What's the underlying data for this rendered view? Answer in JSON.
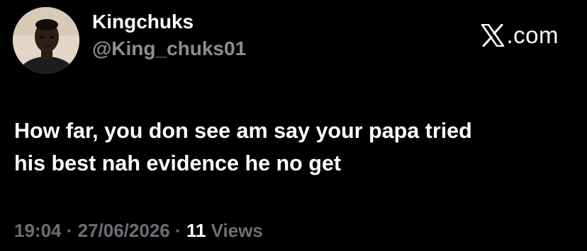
{
  "user": {
    "display_name": "Kingchuks",
    "handle": "@King_chuks01",
    "avatar": "profile-photo"
  },
  "brand": {
    "icon": "x-logo-icon",
    "label": ".com"
  },
  "tweet": {
    "lines": [
      "How far, you don see am say your papa tried",
      "his best nah evidence he no get"
    ]
  },
  "meta": {
    "time": "19:04",
    "separator": " · ",
    "date": "27/06/2026",
    "views_count": "11",
    "views_label": " Views"
  },
  "colors": {
    "background": "#000000",
    "primary_text": "#ffffff",
    "secondary_text": "#8a8d91"
  }
}
